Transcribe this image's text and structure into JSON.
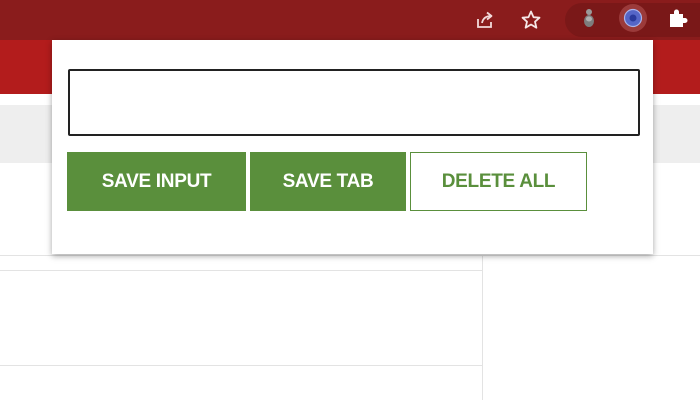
{
  "browser": {
    "toolbar_color": "#8a1c1c",
    "page_header_color": "#b31c1c",
    "icons": [
      "share-icon",
      "bookmark-star-icon",
      "extension-gray-icon",
      "extension-active-icon",
      "extensions-puzzle-icon"
    ]
  },
  "popup": {
    "input": {
      "value": "",
      "placeholder": ""
    },
    "buttons": {
      "save_input": "SAVE INPUT",
      "save_tab": "SAVE TAB",
      "delete_all": "DELETE ALL"
    },
    "accent_color": "#5a8f3c"
  }
}
